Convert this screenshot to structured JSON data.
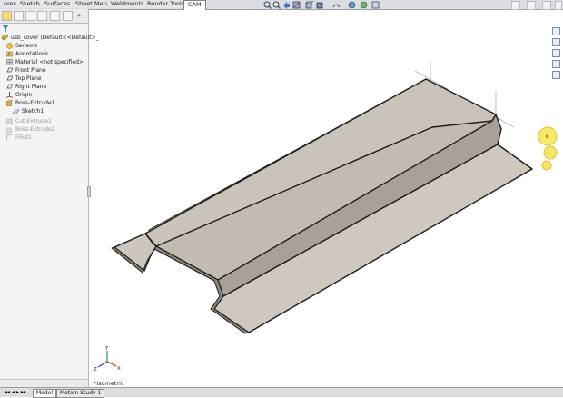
{
  "command_tabs": [
    {
      "label": "ures",
      "active": false
    },
    {
      "label": "Sketch",
      "active": false
    },
    {
      "label": "Surfaces",
      "active": false
    },
    {
      "label": "Sheet Metal",
      "active": false
    },
    {
      "label": "Weldments",
      "active": false
    },
    {
      "label": "Render Tools",
      "active": false
    },
    {
      "label": "CAM",
      "active": true
    }
  ],
  "feature_tree": {
    "root": "usb_cover (Default<<Default>_",
    "items": [
      {
        "label": "Sensors",
        "icon": "sensors-icon",
        "suppressed": false
      },
      {
        "label": "Annotations",
        "icon": "annotations-icon",
        "suppressed": false
      },
      {
        "label": "Material <not specified>",
        "icon": "material-icon",
        "suppressed": false
      },
      {
        "label": "Front Plane",
        "icon": "plane-icon",
        "suppressed": false
      },
      {
        "label": "Top Plane",
        "icon": "plane-icon",
        "suppressed": false
      },
      {
        "label": "Right Plane",
        "icon": "plane-icon",
        "suppressed": false
      },
      {
        "label": "Origin",
        "icon": "origin-icon",
        "suppressed": false
      },
      {
        "label": "Boss-Extrude1",
        "icon": "extrude-icon",
        "suppressed": false
      },
      {
        "label": "Sketch1",
        "icon": "sketch-icon",
        "suppressed": false
      },
      {
        "label": "Cut-Extrude1",
        "icon": "cut-extrude-icon",
        "suppressed": true
      },
      {
        "label": "Boss-Extrude2",
        "icon": "extrude-icon",
        "suppressed": true
      },
      {
        "label": "Fillet1",
        "icon": "fillet-icon",
        "suppressed": true
      }
    ]
  },
  "bottom_tabs": [
    {
      "label": "Model",
      "active": true
    },
    {
      "label": "Motion Study 1",
      "active": false
    }
  ],
  "viewport": {
    "view_orientation": "*Isometric",
    "triad_labels": [
      "Y",
      "X",
      "Z"
    ]
  },
  "colors": {
    "part_face": "#cdc6bd",
    "part_side": "#a9a197",
    "part_edge": "#1c1c1c",
    "accent_blue": "#2f63b6"
  }
}
